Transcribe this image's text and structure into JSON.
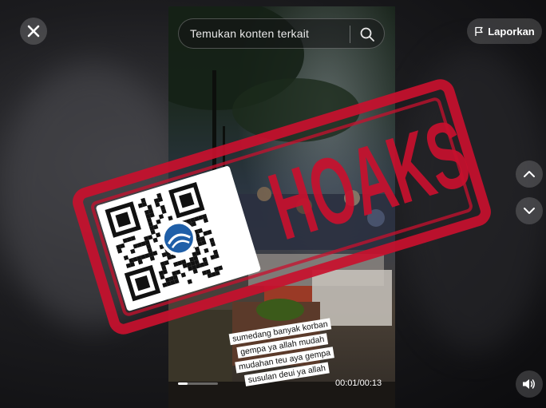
{
  "search": {
    "placeholder": "Temukan konten terkait"
  },
  "report": {
    "label": "Laporkan"
  },
  "stamp": {
    "text": "HOAKS",
    "color": "#c8102e"
  },
  "caption": {
    "lines": [
      "sumedang banyak korban",
      "gempa ya allah mudah",
      "mudahan  teu aya gempa",
      "susulan deui ya allah"
    ]
  },
  "player": {
    "time": "00:01/00:13",
    "progress_fraction": 0.23
  },
  "icons": {
    "close": "close-icon",
    "search": "search-icon",
    "report": "flag-icon",
    "previous": "chevron-up-icon",
    "next": "chevron-down-icon",
    "volume": "volume-icon",
    "qr": "qr-code-icon",
    "logo": "kominfo-logo-icon"
  }
}
